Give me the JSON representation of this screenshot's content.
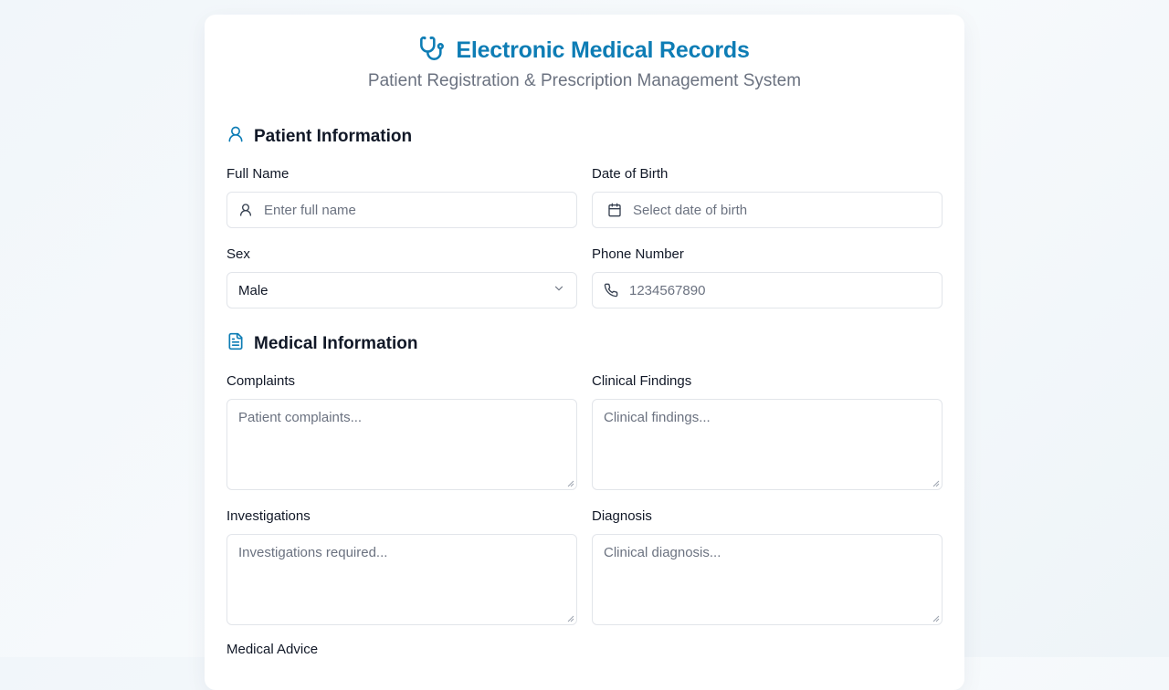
{
  "header": {
    "title": "Electronic Medical Records",
    "subtitle": "Patient Registration & Prescription Management System",
    "icon": "stethoscope-icon",
    "accent_color": "#0e7db5"
  },
  "patient_section": {
    "title": "Patient Information",
    "icon": "user-icon",
    "full_name": {
      "label": "Full Name",
      "placeholder": "Enter full name"
    },
    "dob": {
      "label": "Date of Birth",
      "placeholder": "Select date of birth"
    },
    "sex": {
      "label": "Sex",
      "value": "Male"
    },
    "phone": {
      "label": "Phone Number",
      "placeholder": "1234567890"
    }
  },
  "medical_section": {
    "title": "Medical Information",
    "icon": "document-icon",
    "complaints": {
      "label": "Complaints",
      "placeholder": "Patient complaints..."
    },
    "findings": {
      "label": "Clinical Findings",
      "placeholder": "Clinical findings..."
    },
    "investigations": {
      "label": "Investigations",
      "placeholder": "Investigations required..."
    },
    "diagnosis": {
      "label": "Diagnosis",
      "placeholder": "Clinical diagnosis..."
    },
    "advice": {
      "label": "Medical Advice"
    }
  }
}
